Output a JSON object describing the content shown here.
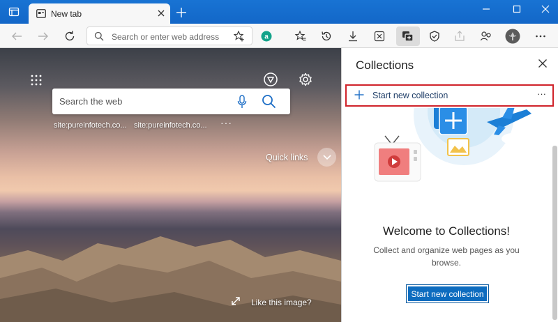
{
  "browser": {
    "tab_title": "New tab",
    "address_placeholder": "Search or enter web address"
  },
  "newtab": {
    "search_placeholder": "Search the web",
    "quick_links": [
      "site:pureinfotech.co...",
      "site:pureinfotech.co..."
    ],
    "more_label": "···",
    "quick_links_label": "Quick links",
    "like_image_label": "Like this image?"
  },
  "collections": {
    "title": "Collections",
    "start_new_label": "Start new collection",
    "more_label": "···",
    "welcome_title": "Welcome to Collections!",
    "welcome_desc": "Collect and organize web pages as you browse.",
    "cta_label": "Start new collection"
  },
  "colors": {
    "titlebar": "#1367c8",
    "highlight": "#d0232a",
    "accent": "#0d6cbf"
  }
}
